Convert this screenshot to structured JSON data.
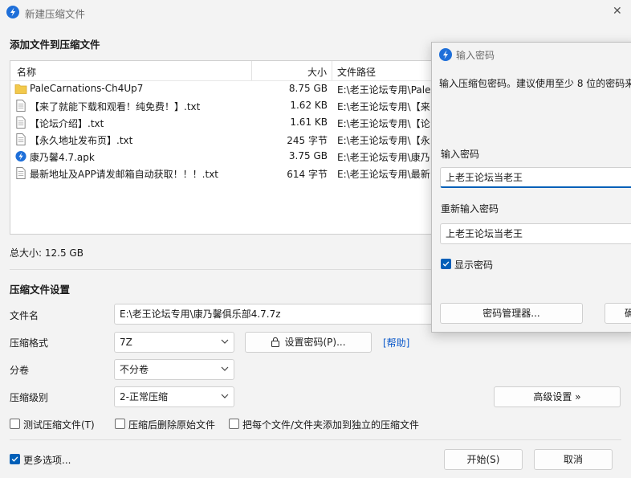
{
  "window": {
    "title": "新建压缩文件",
    "close_glyph": "✕"
  },
  "add_section": {
    "title": "添加文件到压缩文件"
  },
  "file_list": {
    "columns": {
      "name": "名称",
      "size": "大小",
      "path": "文件路径"
    },
    "rows": [
      {
        "icon": "folder-icon",
        "name": "PaleCarnations-Ch4Up7",
        "size": "8.75 GB",
        "path": "E:\\老王论坛专用\\Pale"
      },
      {
        "icon": "text-file-icon",
        "name": "【来了就能下载和观看！纯免费！】.txt",
        "size": "1.62 KB",
        "path": "E:\\老王论坛专用\\【来"
      },
      {
        "icon": "text-file-icon",
        "name": "【论坛介绍】.txt",
        "size": "1.61 KB",
        "path": "E:\\老王论坛专用\\【论"
      },
      {
        "icon": "text-file-icon",
        "name": "【永久地址发布页】.txt",
        "size": "245 字节",
        "path": "E:\\老王论坛专用\\【永"
      },
      {
        "icon": "apk-icon",
        "name": "康乃馨4.7.apk",
        "size": "3.75 GB",
        "path": "E:\\老王论坛专用\\康乃"
      },
      {
        "icon": "text-file-icon",
        "name": "最新地址及APP请发邮箱自动获取！！！.txt",
        "size": "614 字节",
        "path": "E:\\老王论坛专用\\最新"
      }
    ]
  },
  "total_size": "总大小: 12.5 GB",
  "settings": {
    "title": "压缩文件设置",
    "filename_label": "文件名",
    "filename_value": "E:\\老王论坛专用\\康乃馨俱乐部4.7.7z",
    "format_label": "压缩格式",
    "format_value": "7Z",
    "set_password_button": "设置密码(P)...",
    "help_link": "[帮助]",
    "split_label": "分卷",
    "split_value": "不分卷",
    "level_label": "压缩级别",
    "level_value": "2-正常压缩",
    "advanced_button": "高级设置 »"
  },
  "options": {
    "test": {
      "label": "测试压缩文件(T)",
      "checked": false
    },
    "delete": {
      "label": "压缩后删除原始文件",
      "checked": false
    },
    "separate": {
      "label": "把每个文件/文件夹添加到独立的压缩文件",
      "checked": false
    },
    "more": {
      "label": "更多选项...",
      "checked": true
    }
  },
  "footer": {
    "start_button": "开始(S)",
    "cancel_button": "取消"
  },
  "password_dialog": {
    "title": "输入密码",
    "instruction": "输入压缩包密码。建议使用至少 8 位的密码来",
    "password_label": "输入密码",
    "password_value": "上老王论坛当老王",
    "confirm_label": "重新输入密码",
    "confirm_value": "上老王论坛当老王",
    "show_password": {
      "label": "显示密码",
      "checked": true
    },
    "manager_button": "密码管理器...",
    "ok_button": "确"
  },
  "colors": {
    "accent": "#005fb8",
    "folder": "#f2c94c",
    "link": "#0a58ca"
  }
}
